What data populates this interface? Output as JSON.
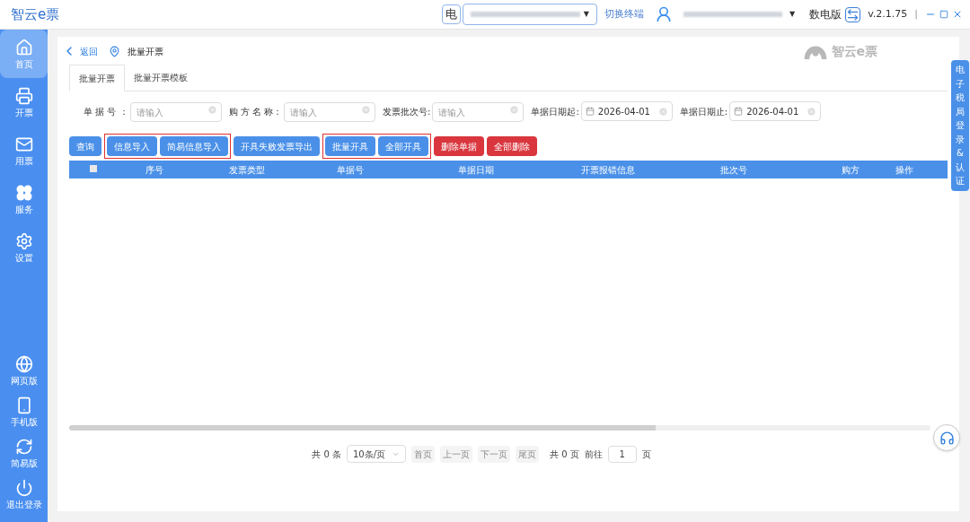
{
  "app": {
    "title": "智云e票"
  },
  "top_bar": {
    "terminal_label": "电",
    "terminal_caret": "▼",
    "user_caret": "▼",
    "switch_terminal": "切换终端",
    "edition": "数电版",
    "version": "v.2.1.75",
    "separator": "|"
  },
  "sidebar": {
    "items": [
      {
        "label": "首页",
        "selected": true
      },
      {
        "label": "开票",
        "selected": false
      },
      {
        "label": "用票",
        "selected": false
      },
      {
        "label": "服务",
        "selected": false
      },
      {
        "label": "设置",
        "selected": false
      }
    ],
    "bottom_items": [
      {
        "label": "网页版"
      },
      {
        "label": "手机版"
      },
      {
        "label": "简易版"
      },
      {
        "label": "退出登录"
      }
    ]
  },
  "breadcrumb": {
    "back": "返回",
    "current": "批量开票"
  },
  "watermark_logo": "智云e票",
  "tabs": [
    {
      "label": "批量开票",
      "selected": true
    },
    {
      "label": "批量开票模板",
      "selected": false
    }
  ],
  "filters": [
    {
      "label": "单 据 号 ：",
      "placeholder": "请输入",
      "kind": "text"
    },
    {
      "label": "购 方 名 称：",
      "placeholder": "请输入",
      "kind": "text"
    },
    {
      "label": "发票批次号:",
      "placeholder": "请输入",
      "kind": "text"
    },
    {
      "label": "单据日期起:",
      "value": "2026-04-01",
      "kind": "date"
    },
    {
      "label": "单据日期止:",
      "value": "2026-04-01",
      "kind": "date"
    }
  ],
  "buttons": [
    {
      "label": "查询",
      "kind": "primary",
      "highlighted": false
    },
    {
      "label": "信息导入",
      "kind": "primary",
      "highlighted": true
    },
    {
      "label": "简易信息导入",
      "kind": "primary",
      "highlighted": true
    },
    {
      "label": "开具失败发票导出",
      "kind": "primary",
      "highlighted": false
    },
    {
      "label": "批量开具",
      "kind": "primary",
      "highlighted": true
    },
    {
      "label": "全部开具",
      "kind": "primary",
      "highlighted": true
    },
    {
      "label": "删除单据",
      "kind": "danger",
      "highlighted": false
    },
    {
      "label": "全部删除",
      "kind": "danger",
      "highlighted": false
    }
  ],
  "table": {
    "select_all_checked": false,
    "columns": [
      "序号",
      "发票类型",
      "单据号",
      "单据日期",
      "开票报错信息",
      "批次号",
      "购方",
      "操作"
    ]
  },
  "pagination": {
    "total": "共 0 条",
    "page_size": "10条/页",
    "first": "首页",
    "prev": "上一页",
    "next": "下一页",
    "last": "尾页",
    "pages": "共 0 页",
    "goto": "前往",
    "page": "1",
    "page_unit": "页"
  },
  "side_tab": {
    "label": "电子税局登录&认证"
  }
}
